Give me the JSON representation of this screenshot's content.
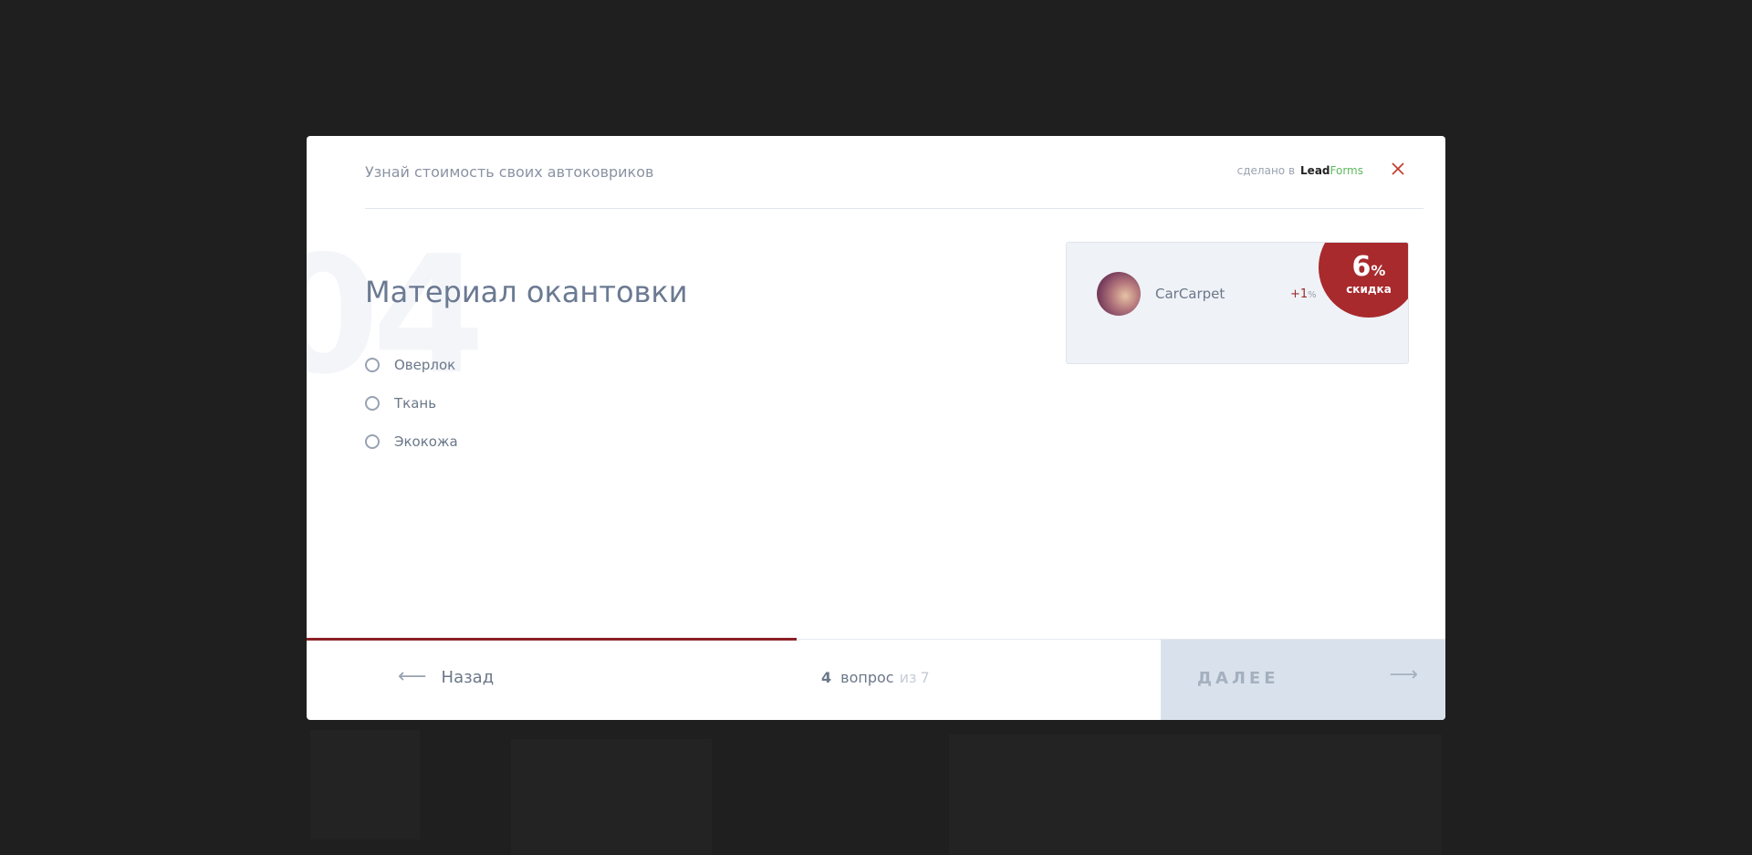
{
  "header": {
    "title": "Узнай стоимость своих автоковриков",
    "made_in": "сделано в",
    "brand_lead": "Lead",
    "brand_forms": "Forms",
    "close_icon": "close-icon"
  },
  "question": {
    "number": "04",
    "title": "Материал окантовки",
    "options": [
      {
        "label": "Оверлок",
        "selected": false
      },
      {
        "label": "Ткань",
        "selected": false
      },
      {
        "label": "Экокожа",
        "selected": false
      }
    ]
  },
  "promo": {
    "name": "CarCarpet",
    "plus": "+1",
    "plus_unit": "%",
    "discount_value": "6",
    "discount_unit": "%",
    "discount_label": "скидка"
  },
  "footer": {
    "back_label": "Назад",
    "counter_current": "4",
    "counter_word": "вопрос",
    "counter_of": "из",
    "counter_total": "7",
    "next_label": "ДАЛЕЕ",
    "progress": 0.43
  },
  "colors": {
    "accent": "#a82a2d",
    "progress": "#8b2126",
    "next_bg": "#d9e2ec"
  }
}
